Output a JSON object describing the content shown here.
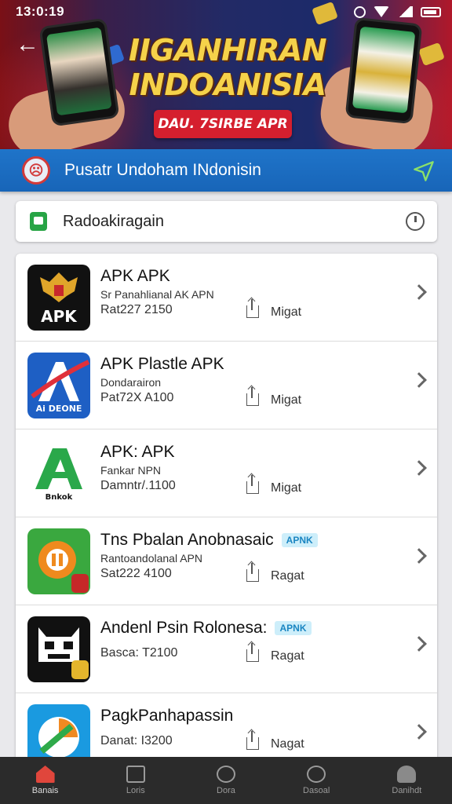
{
  "status_bar": {
    "time": "13:0:19"
  },
  "hero": {
    "title": "IIGANHIRAN INDOANISIA",
    "subtitle": "DAU. 7SIRBE APR"
  },
  "header": {
    "title": "Pusatr Undoham INdonisin"
  },
  "search": {
    "placeholder": "Radoakiragain"
  },
  "apps": [
    {
      "name": "APK APK",
      "badge": "",
      "developer": "Sr Panahlianal AK APN",
      "meta": "Rat227 2150",
      "action": "Migat",
      "icon_label": "APK",
      "icon_bg": "#111111"
    },
    {
      "name": "APK Plastle APK",
      "badge": "",
      "developer": "Dondarairon",
      "meta": "Pat72X A100",
      "action": "Migat",
      "icon_label": "Ai DEONE",
      "icon_bg": "#1e5fc4"
    },
    {
      "name": "APK: APK",
      "badge": "",
      "developer": "Fankar NPN",
      "meta": "Damntr/.1100",
      "action": "Migat",
      "icon_label": "Bnkok",
      "icon_bg": "#ffffff"
    },
    {
      "name": "Tns Pbalan Anobnasaic",
      "badge": "APNK",
      "developer": "Rantoandolanal APN",
      "meta": "Sat222 4100",
      "action": "Ragat",
      "icon_label": "",
      "icon_bg": "#3aa83f"
    },
    {
      "name": "Andenl Psin Rolonesa:",
      "badge": "APNK",
      "developer": "",
      "meta": "Basca: T2100",
      "action": "Ragat",
      "icon_label": "",
      "icon_bg": "#111111"
    },
    {
      "name": "PagkPanhapassin",
      "badge": "",
      "developer": "",
      "meta": "Danat: I3200",
      "action": "Nagat",
      "icon_label": "",
      "icon_bg": "#1a9ae0"
    }
  ],
  "bottom_nav": [
    {
      "label": "Banais",
      "icon": "home-icon",
      "active": true
    },
    {
      "label": "Loris",
      "icon": "square-icon",
      "active": false
    },
    {
      "label": "Dora",
      "icon": "gauge-icon",
      "active": false
    },
    {
      "label": "Dasoal",
      "icon": "heart-icon",
      "active": false
    },
    {
      "label": "Danihdt",
      "icon": "person-icon",
      "active": false
    }
  ],
  "colors": {
    "header": "#1865b8",
    "accent_green": "#27a445",
    "badge_bg": "#cdeefa",
    "hero_pill": "#d51f2e"
  }
}
